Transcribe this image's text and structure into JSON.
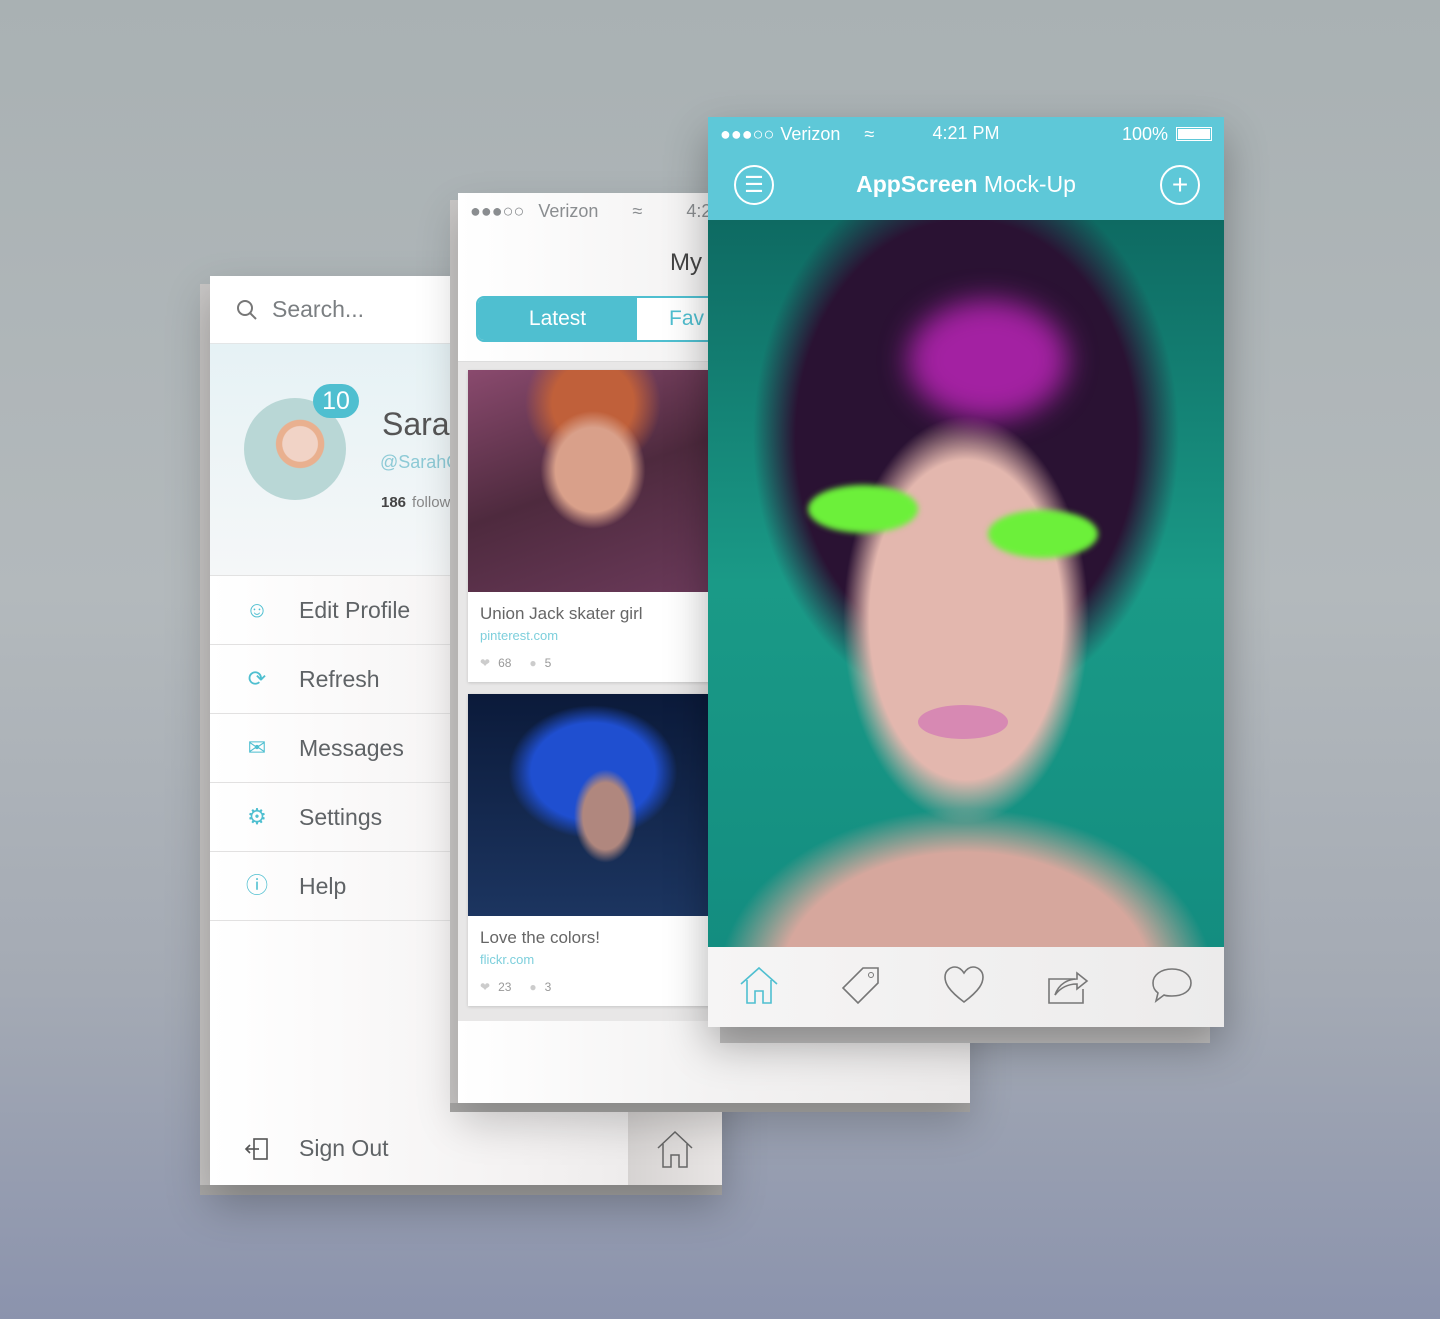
{
  "colors": {
    "accent": "#4fbfd0",
    "header": "#5ec8d8"
  },
  "menu_panel": {
    "search_placeholder": "Search...",
    "notification_count": "10",
    "profile_name": "Sarah",
    "profile_handle": "@SarahC",
    "followers_count": "186",
    "followers_label": "follow",
    "items": [
      {
        "label": "Edit Profile",
        "icon": "user-icon"
      },
      {
        "label": "Refresh",
        "icon": "refresh-icon"
      },
      {
        "label": "Messages",
        "icon": "mail-icon"
      },
      {
        "label": "Settings",
        "icon": "gear-icon"
      },
      {
        "label": "Help",
        "icon": "help-icon"
      }
    ],
    "sign_out": "Sign Out"
  },
  "feed_screen": {
    "status": {
      "carrier": "Verizon",
      "time": "4:2"
    },
    "title": "My",
    "tabs": [
      {
        "label": "Latest",
        "active": true
      },
      {
        "label": "Fav",
        "active": false
      }
    ],
    "cards": [
      {
        "title": "Union Jack skater girl",
        "source": "pinterest.com",
        "likes": "68",
        "comments": "5"
      },
      {
        "title": "Love the colors!",
        "source": "flickr.com",
        "likes": "23",
        "comments": "3"
      }
    ]
  },
  "main_screen": {
    "status": {
      "carrier": "Verizon",
      "time": "4:21 PM",
      "battery": "100%",
      "battery_level": 100
    },
    "title_bold": "AppScreen",
    "title_rest": " Mock-Up",
    "tabbar": [
      "home-icon",
      "tag-icon",
      "heart-icon",
      "share-icon",
      "comment-icon"
    ]
  }
}
